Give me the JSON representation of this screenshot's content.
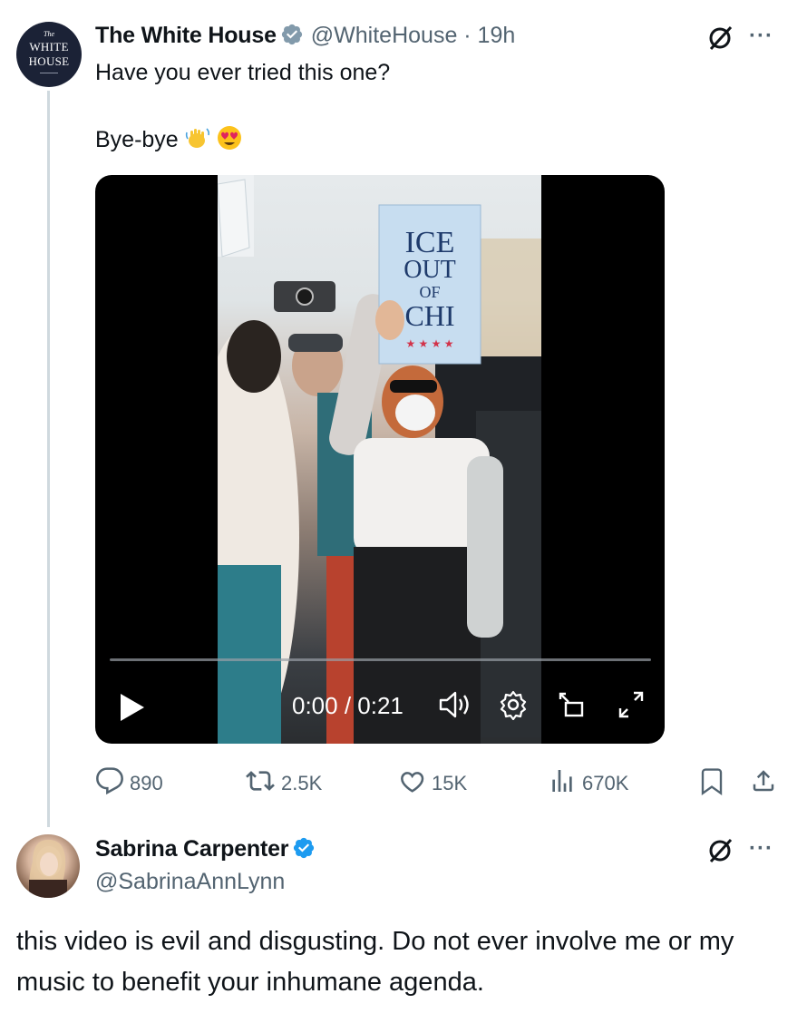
{
  "tweet1": {
    "author_name": "The White House",
    "avatar_text": {
      "small": "The",
      "line1": "WHITE",
      "line2": "HOUSE"
    },
    "handle_time": "@WhiteHouse · 19h",
    "text_line1": "Have you ever tried this one?",
    "text_line2": "Bye-bye",
    "emoji": [
      "waving-hands-icon",
      "heart-eyes-icon"
    ],
    "video": {
      "sign_text": [
        "ICE",
        "OUT",
        "OF",
        "CHI"
      ],
      "time": "0:00 / 0:21",
      "progress": 0,
      "controls": [
        "play-icon",
        "volume-icon",
        "settings-icon",
        "pip-icon",
        "fullscreen-icon"
      ]
    },
    "stats": {
      "replies": "890",
      "reposts": "2.5K",
      "likes": "15K",
      "views": "670K"
    }
  },
  "tweet2": {
    "author_name": "Sabrina Carpenter",
    "handle": "@SabrinaAnnLynn",
    "text": "this video is evil and disgusting. Do not ever involve me or my music to benefit your inhumane agenda."
  },
  "colors": {
    "text": "#0f1419",
    "secondary": "#536471",
    "verified": "#1d9bf0",
    "thread_line": "#cfd9de"
  }
}
